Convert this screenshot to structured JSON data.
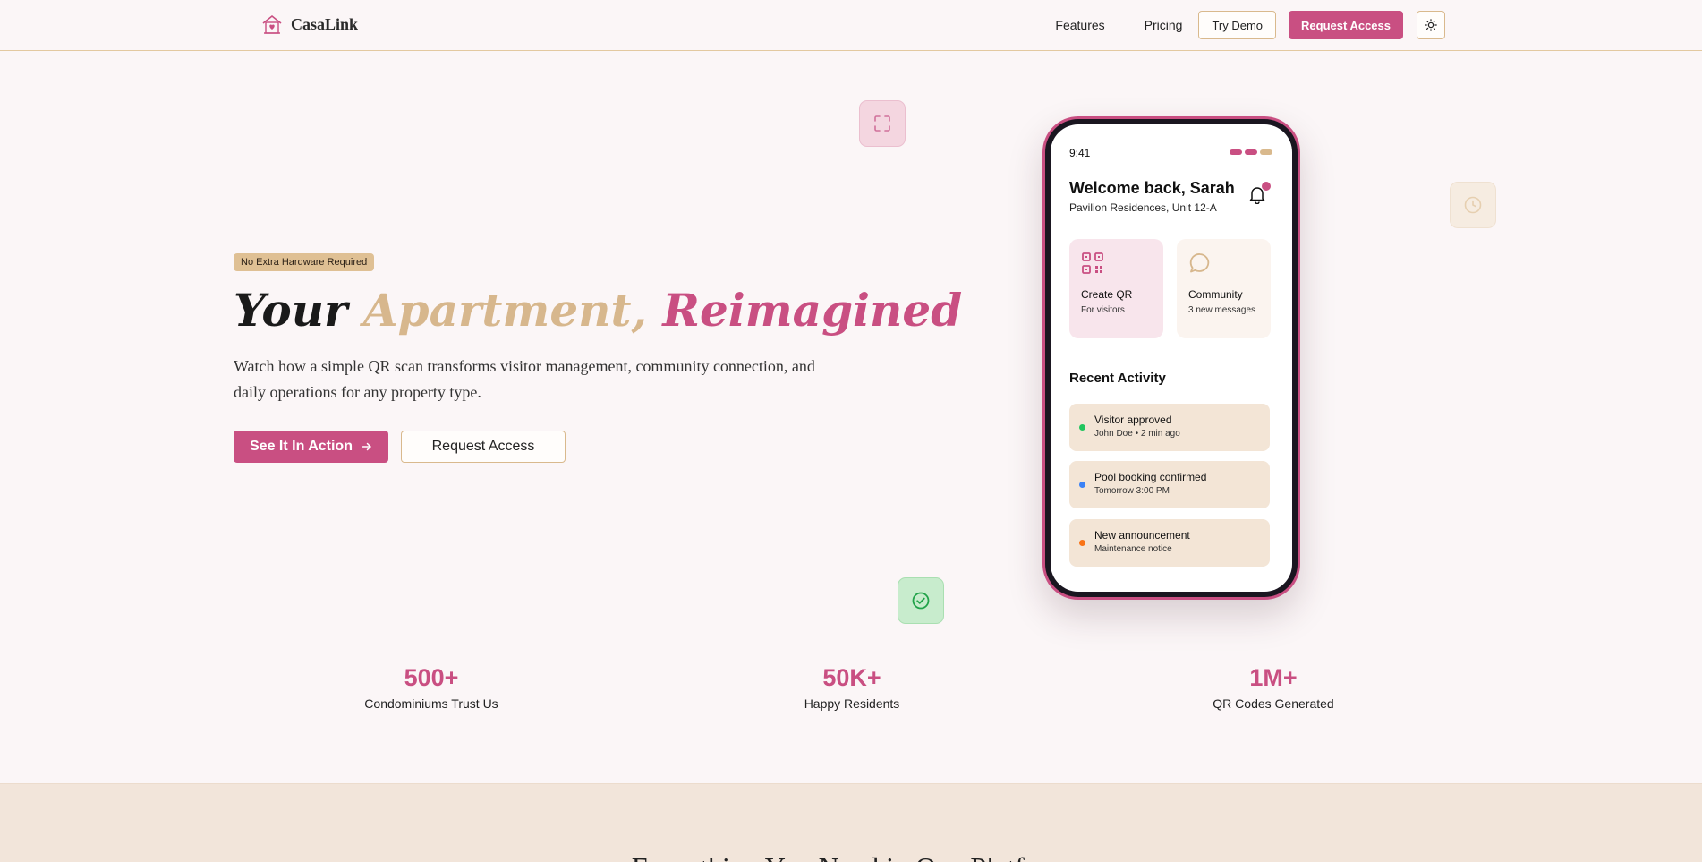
{
  "brand": {
    "name": "CasaLink",
    "icon": "house-heart-icon",
    "accent": "#c94f82",
    "gold": "#d7b78d"
  },
  "nav": {
    "features": "Features",
    "pricing": "Pricing",
    "try_demo": "Try Demo",
    "request_access": "Request Access",
    "theme_icon": "sun-icon"
  },
  "hero": {
    "badge": "No Extra Hardware Required",
    "title_part1": "Your",
    "title_part2": "Apartment,",
    "title_part3": "Reimagined",
    "description": "Watch how a simple QR scan transforms visitor management, community connection, and daily operations for any property type.",
    "cta_primary": "See It In Action",
    "cta_secondary": "Request Access"
  },
  "floating_icons": [
    "scan-icon",
    "clock-icon",
    "check-circle-icon"
  ],
  "phone": {
    "time": "9:41",
    "welcome": "Welcome back, Sarah",
    "unit": "Pavilion Residences, Unit 12-A",
    "cards": [
      {
        "title": "Create QR",
        "subtitle": "For visitors",
        "icon": "qr-code-icon"
      },
      {
        "title": "Community",
        "subtitle": "3 new messages",
        "icon": "chat-icon"
      }
    ],
    "recent_title": "Recent Activity",
    "activities": [
      {
        "title": "Visitor approved",
        "subtitle": "John Doe • 2 min ago",
        "color": "#22c55e"
      },
      {
        "title": "Pool booking confirmed",
        "subtitle": "Tomorrow 3:00 PM",
        "color": "#3b82f6"
      },
      {
        "title": "New announcement",
        "subtitle": "Maintenance notice",
        "color": "#f97316"
      }
    ]
  },
  "stats": [
    {
      "value": "500+",
      "label": "Condominiums Trust Us"
    },
    {
      "value": "50K+",
      "label": "Happy Residents"
    },
    {
      "value": "1M+",
      "label": "QR Codes Generated"
    }
  ],
  "next_section": {
    "title": "Everything You Need in One Platform"
  }
}
